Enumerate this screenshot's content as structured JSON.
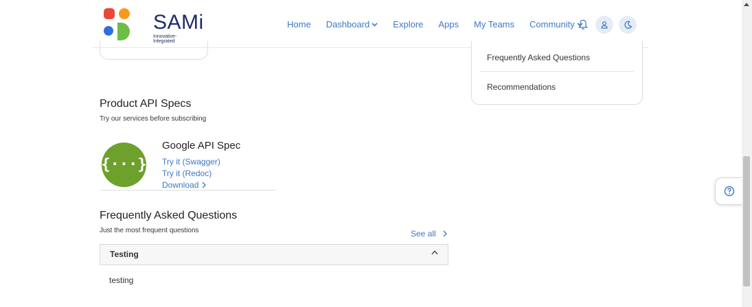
{
  "brand": {
    "name": "SAMi",
    "tagline": "Innovative-Integrated",
    "colors": {
      "red": "#e8493a",
      "orange": "#f59a1b",
      "blue": "#2f6fdc",
      "green": "#6cbe45",
      "navy": "#1c2b6b"
    }
  },
  "nav": {
    "home": "Home",
    "dashboard": "Dashboard",
    "explore": "Explore",
    "apps": "Apps",
    "my_teams": "My Teams",
    "community": "Community"
  },
  "sidebar": {
    "items": [
      {
        "label": "Frequently Asked Questions"
      },
      {
        "label": "Recommendations"
      }
    ]
  },
  "api_section": {
    "title": "Product API Specs",
    "subtitle": "Try our services before subscribing",
    "spec": {
      "name": "Google API Spec",
      "links": [
        {
          "label": "Try it (Swagger)"
        },
        {
          "label": "Try it (Redoc)"
        },
        {
          "label": "Download"
        }
      ],
      "logo_glyph": "{···}"
    }
  },
  "faq": {
    "title": "Frequently Asked Questions",
    "subtitle": "Just the most frequent questions",
    "see_all": "See all",
    "items": [
      {
        "question": "Testing",
        "answer": "testing"
      }
    ]
  },
  "accent_color": "#3b78c5"
}
